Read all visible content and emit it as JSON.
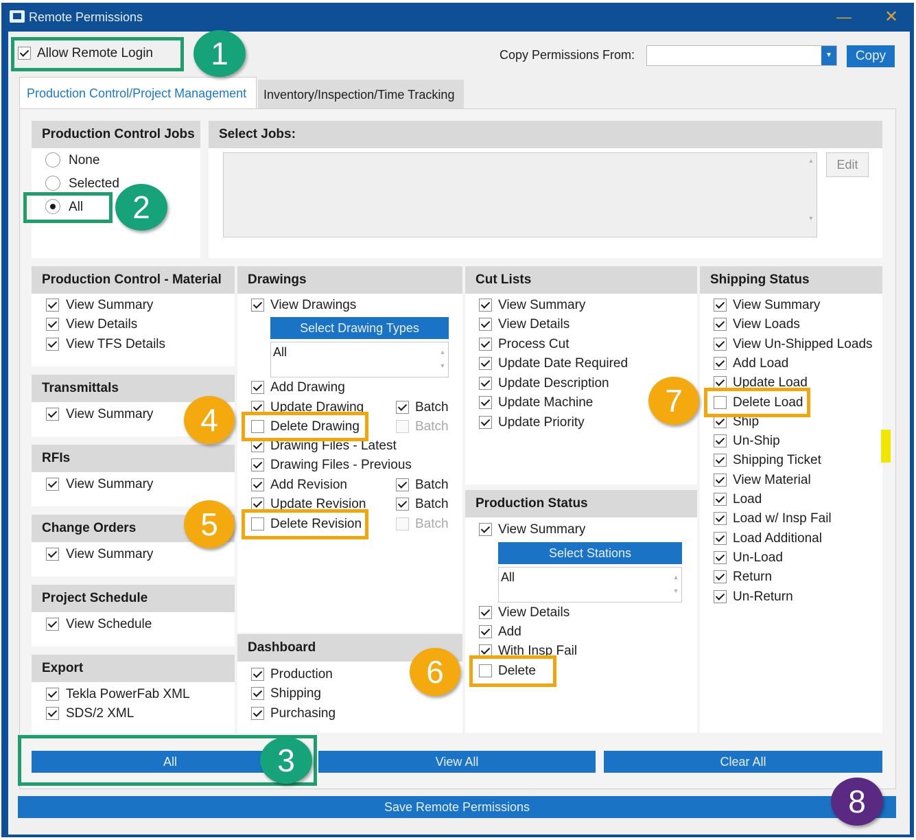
{
  "window": {
    "title": "Remote Permissions",
    "minimize": "—",
    "close": "✕"
  },
  "top": {
    "allow_remote_login": "Allow Remote Login",
    "copy_from_label": "Copy Permissions From:",
    "copy_from_value": "",
    "copy_button": "Copy"
  },
  "tabs": [
    "Production Control/Project Management",
    "Inventory/Inspection/Time Tracking"
  ],
  "jobs": {
    "header": "Production Control Jobs",
    "options": [
      "None",
      "Selected",
      "All"
    ],
    "selected": "All",
    "select_jobs_header": "Select Jobs:",
    "edit_button": "Edit"
  },
  "material": {
    "header": "Production Control - Material",
    "items": [
      "View Summary",
      "View Details",
      "View TFS Details"
    ]
  },
  "transmittals": {
    "header": "Transmittals",
    "items": [
      "View Summary"
    ]
  },
  "rfis": {
    "header": "RFIs",
    "items": [
      "View Summary"
    ]
  },
  "change_orders": {
    "header": "Change Orders",
    "items": [
      "View Summary"
    ]
  },
  "project_schedule": {
    "header": "Project Schedule",
    "items": [
      "View Schedule"
    ]
  },
  "export": {
    "header": "Export",
    "items": [
      "Tekla PowerFab XML",
      "SDS/2 XML"
    ]
  },
  "drawings": {
    "header": "Drawings",
    "view": "View Drawings",
    "types_button": "Select Drawing Types",
    "types_value": "All",
    "items": [
      "Add Drawing",
      "Update Drawing",
      "Delete Drawing",
      "Drawing Files - Latest",
      "Drawing Files - Previous",
      "Add Revision",
      "Update Revision",
      "Delete Revision"
    ],
    "batch": "Batch"
  },
  "dashboard": {
    "header": "Dashboard",
    "items": [
      "Production",
      "Shipping",
      "Purchasing"
    ]
  },
  "cut_lists": {
    "header": "Cut Lists",
    "items": [
      "View Summary",
      "View Details",
      "Process Cut",
      "Update Date Required",
      "Update Description",
      "Update Machine",
      "Update Priority"
    ]
  },
  "production_status": {
    "header": "Production Status",
    "view": "View Summary",
    "stations_button": "Select Stations",
    "stations_value": "All",
    "items": [
      "View Details",
      "Add",
      "With Insp Fail",
      "Delete"
    ]
  },
  "shipping": {
    "header": "Shipping Status",
    "items": [
      "View Summary",
      "View Loads",
      "View Un-Shipped Loads",
      "Add Load",
      "Update Load",
      "Delete Load",
      "Ship",
      "Un-Ship",
      "Shipping Ticket",
      "View Material",
      "Load",
      "Load w/ Insp Fail",
      "Load Additional",
      "Un-Load",
      "Return",
      "Un-Return"
    ]
  },
  "bottom": {
    "all": "All",
    "view_all": "View All",
    "clear_all": "Clear All",
    "save": "Save Remote Permissions"
  },
  "badges": [
    "1",
    "2",
    "3",
    "4",
    "5",
    "6",
    "7",
    "8"
  ],
  "colors": {
    "title_bar": "#0f4f95",
    "button_blue": "#1a73c4",
    "callout_green": "#1e9e6e",
    "callout_orange": "#f2a50c",
    "callout_purple": "#5a2a82"
  }
}
